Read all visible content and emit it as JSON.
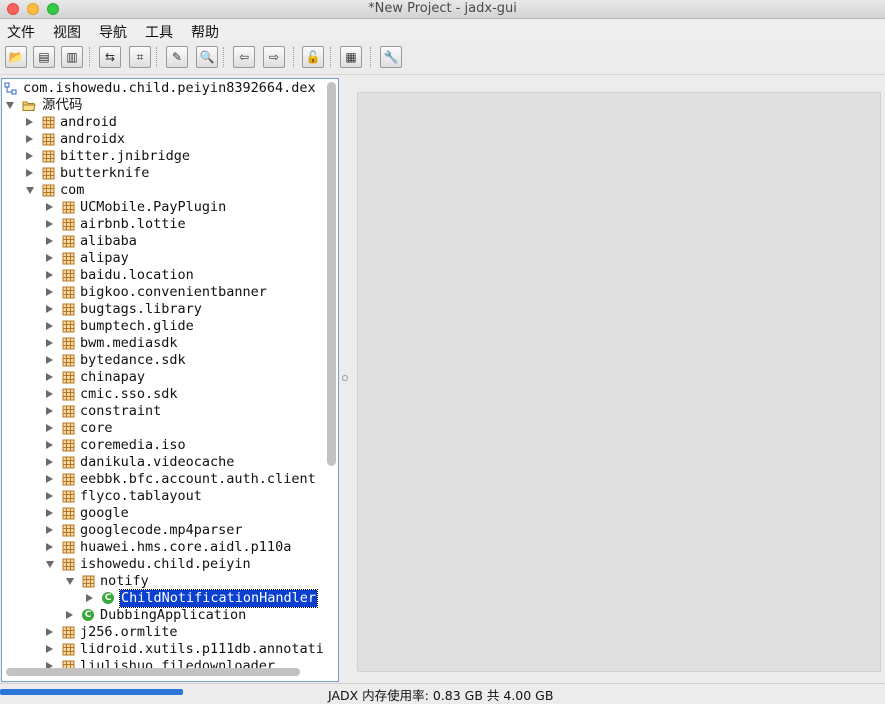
{
  "window": {
    "title": "*New Project - jadx-gui"
  },
  "menu": [
    "文件",
    "视图",
    "导航",
    "工具",
    "帮助"
  ],
  "toolbar": [
    {
      "name": "open-file-button",
      "glyph": "📂"
    },
    {
      "name": "save-all-button",
      "glyph": "▤"
    },
    {
      "name": "export-button",
      "glyph": "▥"
    },
    {
      "name": "sync-tree-button",
      "glyph": "⇆"
    },
    {
      "name": "flatten-packages-button",
      "glyph": "⌗"
    },
    {
      "name": "search-text-button",
      "glyph": "✎"
    },
    {
      "name": "search-class-button",
      "glyph": "🔍"
    },
    {
      "name": "back-button",
      "glyph": "⇦"
    },
    {
      "name": "forward-button",
      "glyph": "⇨"
    },
    {
      "name": "decompile-all-button",
      "glyph": "🔓"
    },
    {
      "name": "log-viewer-button",
      "glyph": "▦"
    },
    {
      "name": "preferences-button",
      "glyph": "🔧"
    }
  ],
  "tree": {
    "root": "com.ishowedu.child.peiyin8392664.dex",
    "source_folder": "源代码",
    "items": [
      {
        "label": "android",
        "depth": 1,
        "state": "closed",
        "type": "pkg"
      },
      {
        "label": "androidx",
        "depth": 1,
        "state": "closed",
        "type": "pkg"
      },
      {
        "label": "bitter.jnibridge",
        "depth": 1,
        "state": "closed",
        "type": "pkg"
      },
      {
        "label": "butterknife",
        "depth": 1,
        "state": "closed",
        "type": "pkg"
      },
      {
        "label": "com",
        "depth": 1,
        "state": "open",
        "type": "pkg"
      },
      {
        "label": "UCMobile.PayPlugin",
        "depth": 2,
        "state": "closed",
        "type": "pkg"
      },
      {
        "label": "airbnb.lottie",
        "depth": 2,
        "state": "closed",
        "type": "pkg"
      },
      {
        "label": "alibaba",
        "depth": 2,
        "state": "closed",
        "type": "pkg"
      },
      {
        "label": "alipay",
        "depth": 2,
        "state": "closed",
        "type": "pkg"
      },
      {
        "label": "baidu.location",
        "depth": 2,
        "state": "closed",
        "type": "pkg"
      },
      {
        "label": "bigkoo.convenientbanner",
        "depth": 2,
        "state": "closed",
        "type": "pkg"
      },
      {
        "label": "bugtags.library",
        "depth": 2,
        "state": "closed",
        "type": "pkg"
      },
      {
        "label": "bumptech.glide",
        "depth": 2,
        "state": "closed",
        "type": "pkg"
      },
      {
        "label": "bwm.mediasdk",
        "depth": 2,
        "state": "closed",
        "type": "pkg"
      },
      {
        "label": "bytedance.sdk",
        "depth": 2,
        "state": "closed",
        "type": "pkg"
      },
      {
        "label": "chinapay",
        "depth": 2,
        "state": "closed",
        "type": "pkg"
      },
      {
        "label": "cmic.sso.sdk",
        "depth": 2,
        "state": "closed",
        "type": "pkg"
      },
      {
        "label": "constraint",
        "depth": 2,
        "state": "closed",
        "type": "pkg"
      },
      {
        "label": "core",
        "depth": 2,
        "state": "closed",
        "type": "pkg"
      },
      {
        "label": "coremedia.iso",
        "depth": 2,
        "state": "closed",
        "type": "pkg"
      },
      {
        "label": "danikula.videocache",
        "depth": 2,
        "state": "closed",
        "type": "pkg"
      },
      {
        "label": "eebbk.bfc.account.auth.client",
        "depth": 2,
        "state": "closed",
        "type": "pkg"
      },
      {
        "label": "flyco.tablayout",
        "depth": 2,
        "state": "closed",
        "type": "pkg"
      },
      {
        "label": "google",
        "depth": 2,
        "state": "closed",
        "type": "pkg"
      },
      {
        "label": "googlecode.mp4parser",
        "depth": 2,
        "state": "closed",
        "type": "pkg"
      },
      {
        "label": "huawei.hms.core.aidl.p110a",
        "depth": 2,
        "state": "closed",
        "type": "pkg"
      },
      {
        "label": "ishowedu.child.peiyin",
        "depth": 2,
        "state": "open",
        "type": "pkg"
      },
      {
        "label": "notify",
        "depth": 3,
        "state": "open",
        "type": "pkg"
      },
      {
        "label": "ChildNotificationHandler",
        "depth": 4,
        "state": "closed",
        "type": "class",
        "selected": true
      },
      {
        "label": "DubbingApplication",
        "depth": 3,
        "state": "closed",
        "type": "class"
      },
      {
        "label": "j256.ormlite",
        "depth": 2,
        "state": "closed",
        "type": "pkg"
      },
      {
        "label": "lidroid.xutils.p111db.annotati",
        "depth": 2,
        "state": "closed",
        "type": "pkg"
      },
      {
        "label": "liulishuo.filedownloader",
        "depth": 2,
        "state": "closed",
        "type": "pkg"
      }
    ]
  },
  "status": {
    "memory_text": "JADX 内存使用率: 0.83 GB 共 4.00 GB",
    "memory_fraction": 0.207
  },
  "colors": {
    "selection": "#0b3fd0",
    "package_icon": "#b8761f",
    "class_icon": "#3aa83a",
    "memory_bar": "#2a75d8"
  }
}
